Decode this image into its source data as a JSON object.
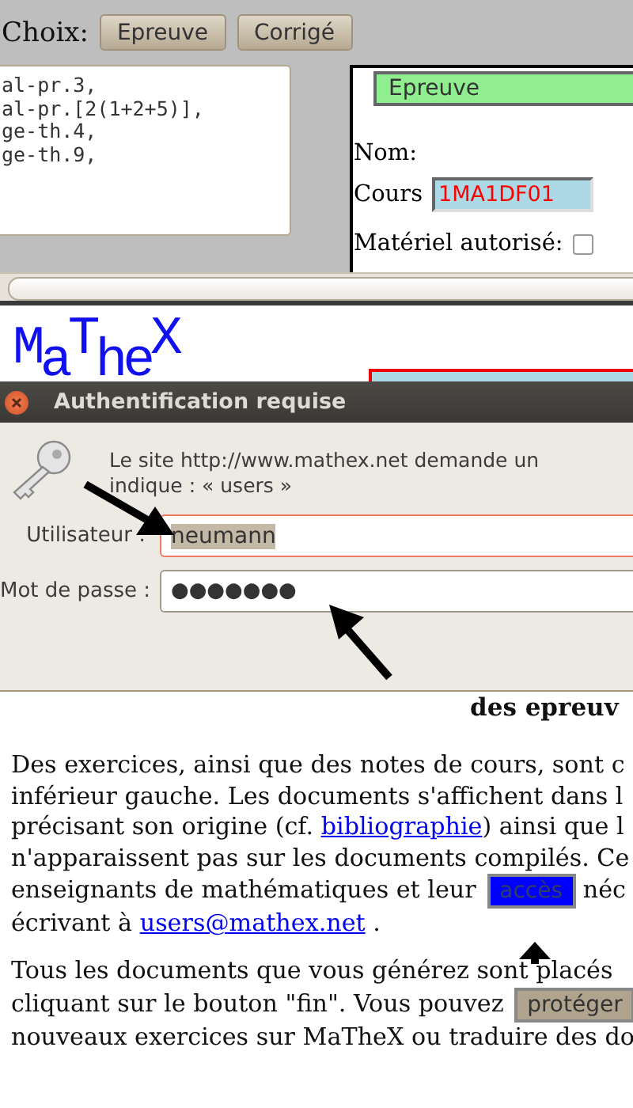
{
  "toolbar": {
    "label": "Choix:",
    "buttons": [
      "Epreuve",
      "Corrigé"
    ]
  },
  "editor": {
    "lines": [
      "al-pr.3,",
      "al-pr.[2(1+2+5)],",
      "ge-th.4,",
      "ge-th.9,"
    ]
  },
  "form": {
    "select": "Epreuve",
    "name_label": "Nom:",
    "course_label": "Cours",
    "course_value": "1MA1DF01",
    "material_label": "Matériel autorisé:",
    "material_checked": false
  },
  "logo": {
    "letters": [
      {
        "char": "M",
        "kind": "base"
      },
      {
        "char": "a",
        "kind": "low"
      },
      {
        "char": "T",
        "kind": "high"
      },
      {
        "char": "h",
        "kind": "low"
      },
      {
        "char": "e",
        "kind": "low"
      },
      {
        "char": "X",
        "kind": "high"
      }
    ]
  },
  "dialog": {
    "title": "Authentification requise",
    "message_lines": [
      "Le site http://www.mathex.net demande un",
      "indique : « users »"
    ],
    "fields": [
      {
        "label": "Utilisateur :",
        "kind": "text",
        "value": "neumann",
        "focused": true
      },
      {
        "label": "Mot de passe :",
        "kind": "password",
        "value": "●●●●●●●",
        "focused": false
      }
    ]
  },
  "heading": "des epreuv",
  "paragraphs": [
    {
      "lines": [
        [
          {
            "kind": "text",
            "text": "Des exercices, ainsi que des notes de cours, sont c"
          }
        ],
        [
          {
            "kind": "text",
            "text": "inférieur gauche. Les documents s'affichent dans l"
          }
        ],
        [
          {
            "kind": "text",
            "text": "précisant son origine (cf. "
          },
          {
            "kind": "link",
            "text": "bibliographie"
          },
          {
            "kind": "text",
            "text": ") ainsi que l"
          }
        ],
        [
          {
            "kind": "text",
            "text": "n'apparaissent pas sur les documents compilés. Ce"
          }
        ],
        [
          {
            "kind": "text",
            "text": "enseignants de mathématiques et leur "
          },
          {
            "kind": "button",
            "text": "accès",
            "color": "#0000ff"
          },
          {
            "kind": "text",
            "text": " néc"
          }
        ],
        [
          {
            "kind": "text",
            "text": "écrivant à "
          },
          {
            "kind": "link",
            "text": "users@mathex.net"
          },
          {
            "kind": "text",
            "text": " ."
          }
        ]
      ]
    },
    {
      "lines": [
        [
          {
            "kind": "text",
            "text": "Tous les documents que vous générez sont placés"
          }
        ],
        [
          {
            "kind": "text",
            "text": "cliquant sur le bouton \"fin\". Vous pouvez "
          },
          {
            "kind": "button",
            "text": "protéger",
            "color": "#b0a48e"
          }
        ],
        [
          {
            "kind": "text",
            "text": "nouveaux exercices sur MaTheX ou traduire des do"
          }
        ]
      ]
    }
  ]
}
